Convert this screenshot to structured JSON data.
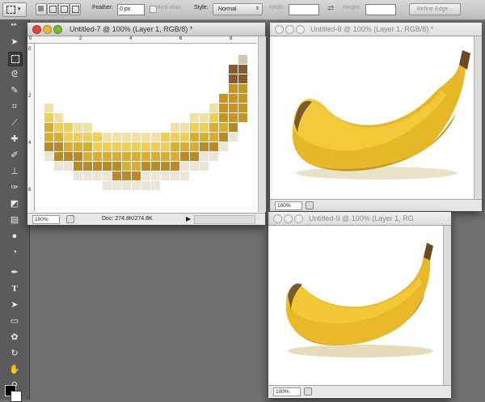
{
  "options_bar": {
    "feather_label": "Feather:",
    "feather_value": "0 px",
    "anti_alias_label": "Anti-alias",
    "style_label": "Style:",
    "style_value": "Normal",
    "width_label": "Width:",
    "height_label": "Height:",
    "refine_edge_label": "Refine Edge..."
  },
  "window_7": {
    "title": "Untitled-7 @ 100% (Layer 1, RGB/8) *",
    "zoom": "100%",
    "doc_info": "Doc: 274.8K/274.8K",
    "ruler_labels": [
      "0",
      "2",
      "4",
      "6",
      "8"
    ]
  },
  "window_8": {
    "title": "Untitled-8 @ 100% (Layer 1, RGB/8) *",
    "zoom": "100%"
  },
  "window_9": {
    "title": "Untitled-9 @ 100% (Layer 1, RG",
    "zoom": "100%"
  },
  "colors": {
    "app_bg": "#6f6f6f",
    "toolbox_bg": "#5b5b5b",
    "banana_yellow": "#e6b828",
    "banana_shadow": "#c8921c",
    "banana_tip": "#6b4a22"
  }
}
